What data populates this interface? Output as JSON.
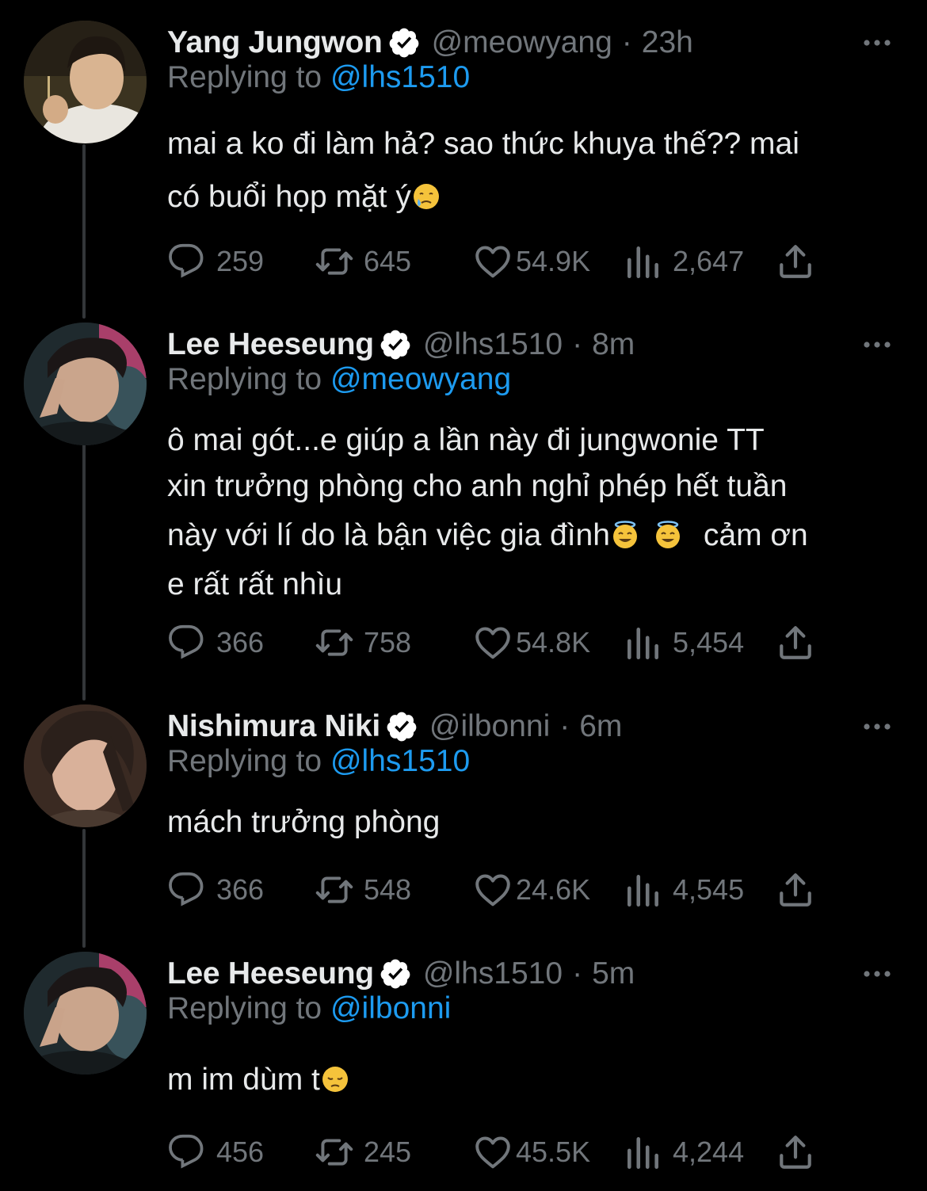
{
  "colors": {
    "background": "#000000",
    "primary_text": "#e7e9ea",
    "secondary_text": "#71767b",
    "link": "#1d9bf0",
    "verified_badge": "#ffffff",
    "thread_line": "#333639"
  },
  "tweets": [
    {
      "name": "Yang Jungwon",
      "handle": "@meowyang",
      "dot": "·",
      "time": "23h",
      "replying_prefix": "Replying to ",
      "replying_to": "@lhs1510",
      "lines": [
        "mai a ko đi làm hả? sao thức khuya thế?? mai",
        "có buổi họp mặt ý"
      ],
      "emoji": "crying-face-emoji",
      "replies": "259",
      "retweets": "645",
      "likes": "54.9K",
      "views": "2,647",
      "avatar": "avatar-jungwon"
    },
    {
      "name": "Lee Heeseung",
      "handle": "@lhs1510",
      "dot": "·",
      "time": "8m",
      "replying_prefix": "Replying to ",
      "replying_to": "@meowyang",
      "lines": [
        "ô mai gót...e giúp a lần này đi jungwonie TT",
        "xin trưởng phòng cho anh nghỉ phép hết tuần",
        "này với lí do là bận việc gia đình",
        "cảm ơn",
        "e rất rất nhìu"
      ],
      "emoji": "halo-face-emoji",
      "replies": "366",
      "retweets": "758",
      "likes": "54.8K",
      "views": "5,454",
      "avatar": "avatar-heeseung"
    },
    {
      "name": "Nishimura Niki",
      "handle": "@ilbonni",
      "dot": "·",
      "time": "6m",
      "replying_prefix": "Replying to ",
      "replying_to": "@lhs1510",
      "lines": [
        "mách trưởng phòng"
      ],
      "replies": "366",
      "retweets": "548",
      "likes": "24.6K",
      "views": "4,545",
      "avatar": "avatar-niki"
    },
    {
      "name": "Lee Heeseung",
      "handle": "@lhs1510",
      "dot": "·",
      "time": "5m",
      "replying_prefix": "Replying to ",
      "replying_to": "@ilbonni",
      "lines": [
        "m im dùm t"
      ],
      "emoji": "pensive-face-emoji",
      "replies": "456",
      "retweets": "245",
      "likes": "45.5K",
      "views": "4,244",
      "avatar": "avatar-heeseung"
    }
  ]
}
